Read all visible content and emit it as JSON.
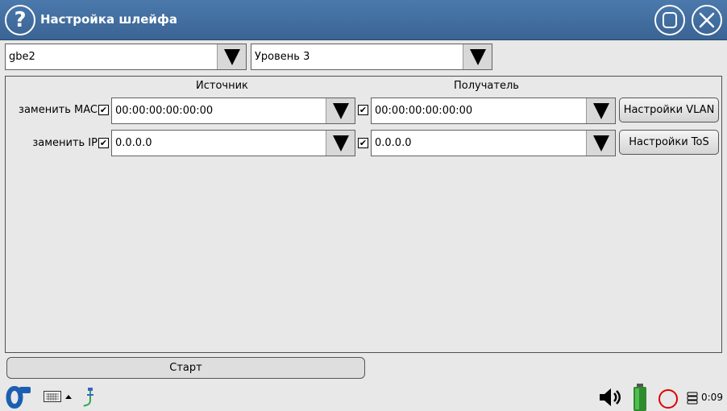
{
  "window": {
    "title": "Настройка шлейфа"
  },
  "top": {
    "interface_value": "gbe2",
    "level_value": "Уровень 3"
  },
  "panel": {
    "source_header": "Источник",
    "dest_header": "Получатель",
    "mac_label": "заменить MAC",
    "ip_label": "заменить IP",
    "source_mac": "00:00:00:00:00:00",
    "dest_mac": "00:00:00:00:00:00",
    "source_ip": "0.0.0.0",
    "dest_ip": "0.0.0.0",
    "vlan_button": "Настройки VLAN",
    "tos_button": "Настройки ToS",
    "checked_mark": "✔"
  },
  "bottom": {
    "start_button": "Старт"
  },
  "statusbar": {
    "time": "0:09"
  },
  "colors": {
    "titlebar": "#4472a6",
    "battery": "#2e8b2e",
    "record": "#e00000"
  }
}
